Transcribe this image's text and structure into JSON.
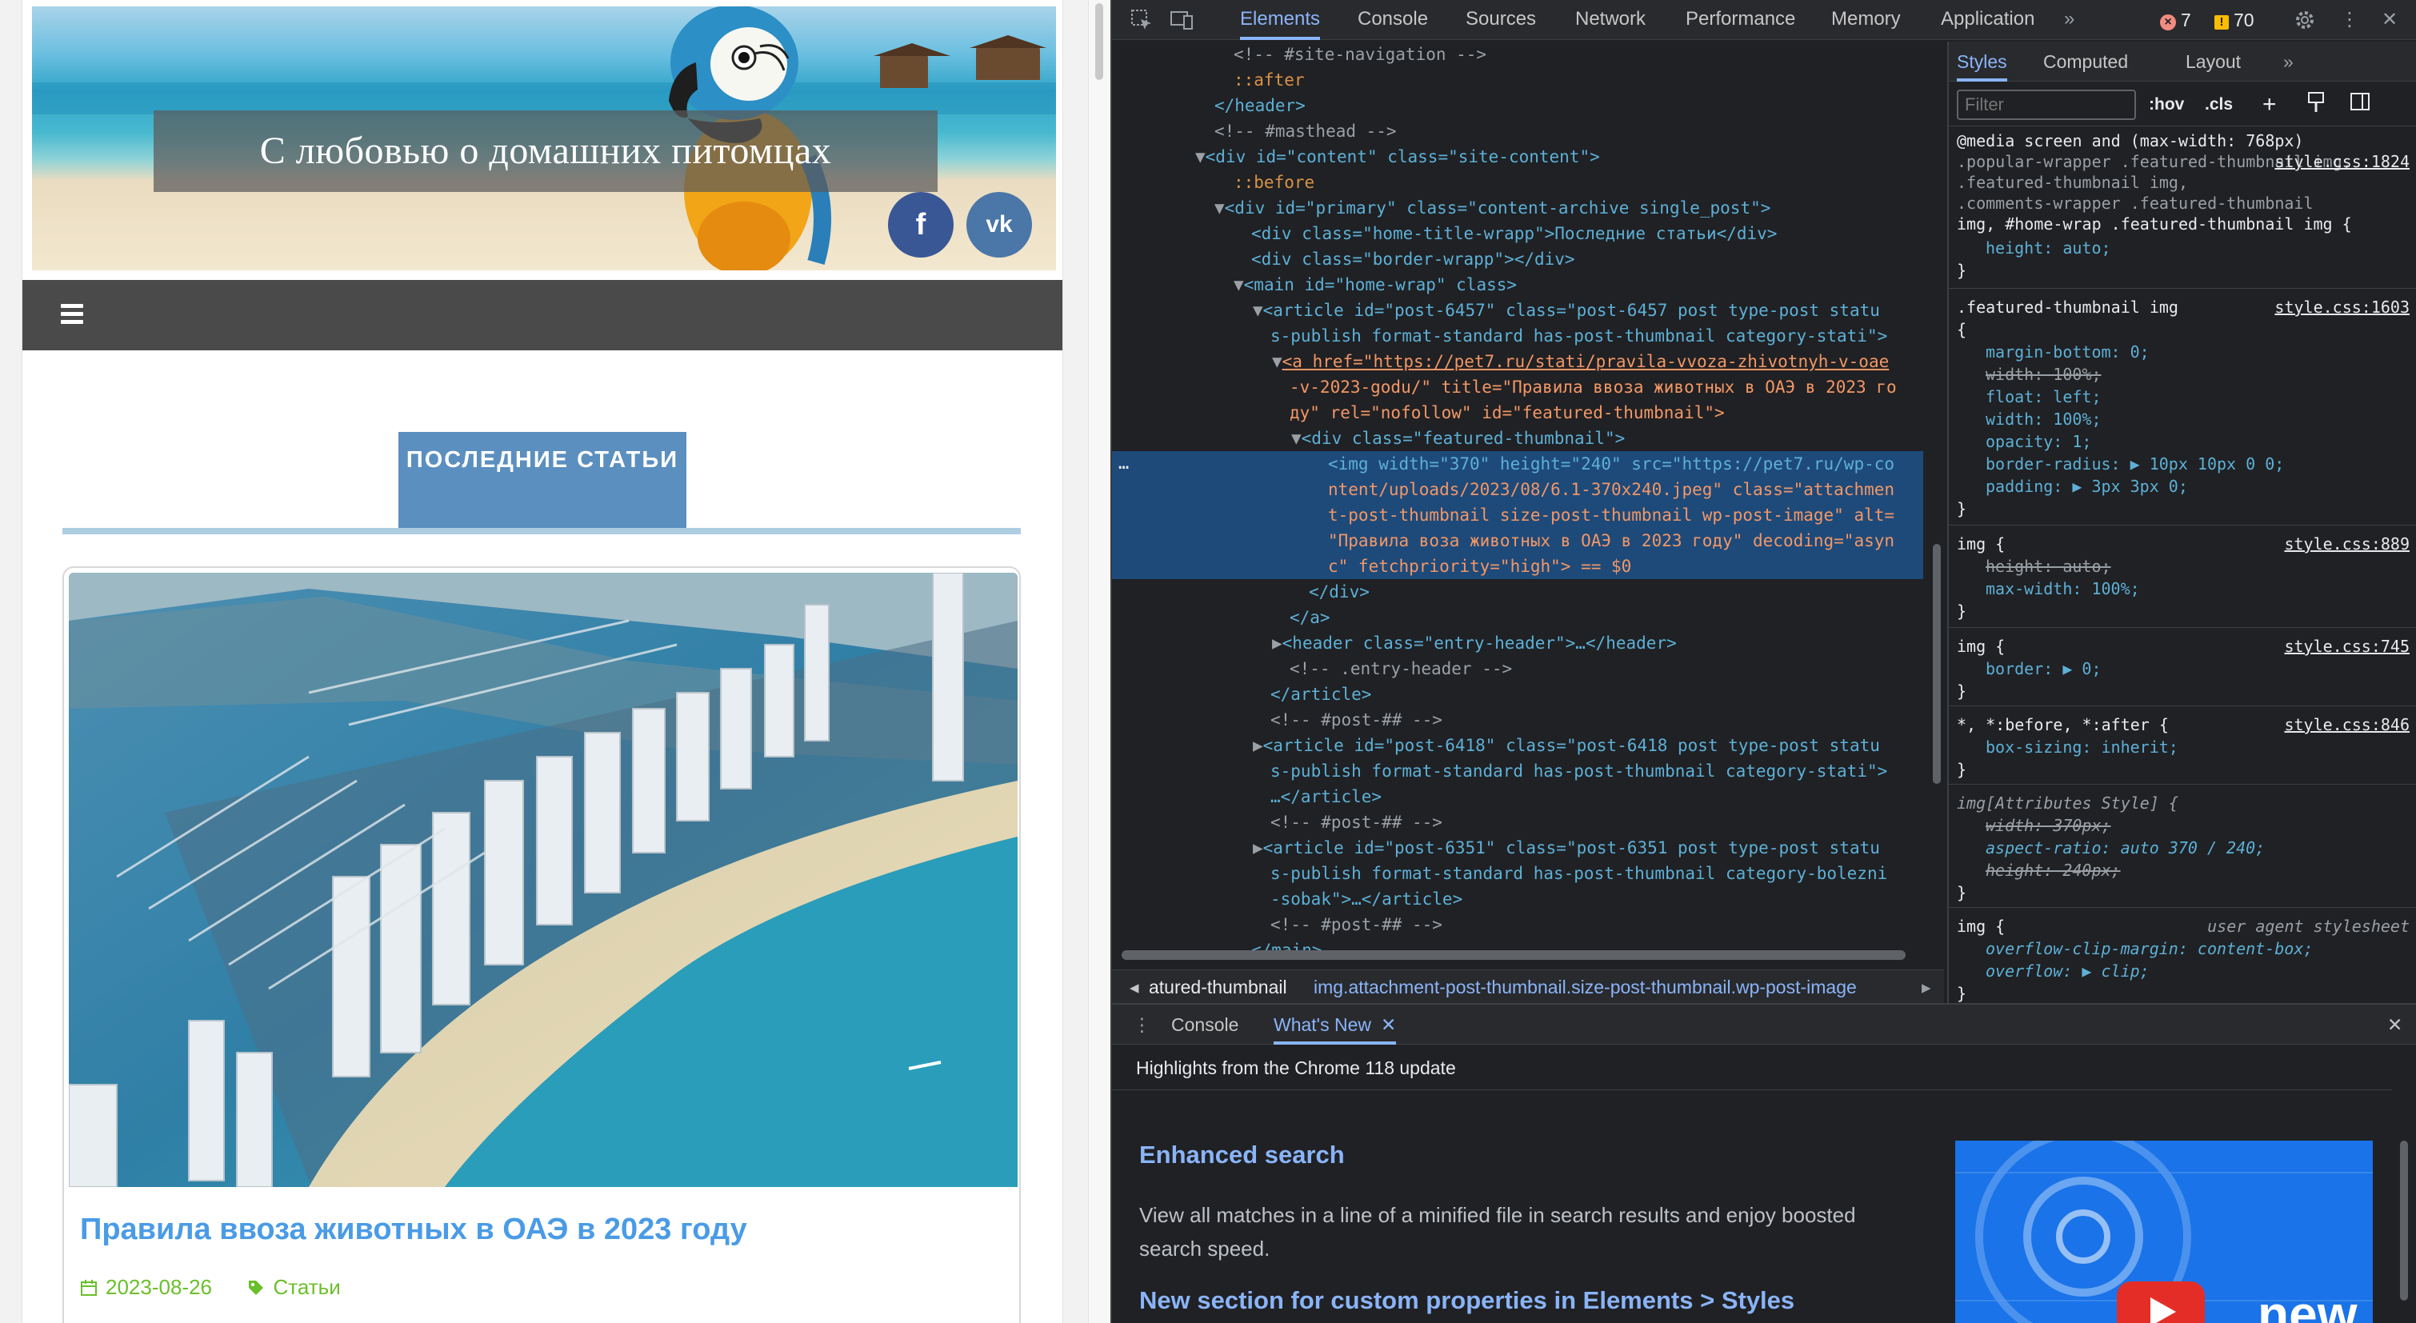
{
  "site": {
    "title": "С любовью о домашних питомцах",
    "social": {
      "facebook": "f",
      "vk": "vk"
    },
    "section_label": "ПОСЛЕДНИЕ СТАТЬИ",
    "post": {
      "title": "Правила ввоза животных в ОАЭ в 2023 году",
      "date": "2023-08-26",
      "category": "Статьи"
    },
    "colors": {
      "nav": "#4a4a4a",
      "tab": "#5b8fbf",
      "title": "#4a9be6",
      "meta": "#6bbf2a"
    }
  },
  "devtools": {
    "tabs": [
      "Elements",
      "Console",
      "Sources",
      "Network",
      "Performance",
      "Memory",
      "Application"
    ],
    "active_tab": "Elements",
    "more_tabs": "»",
    "errors": "7",
    "warnings": "70",
    "dom_lines": [
      "<!-- #site-navigation -->",
      "::after",
      "</header>",
      "<!-- #masthead -->",
      "<div id=\"content\" class=\"site-content\">",
      "::before",
      "<div id=\"primary\" class=\"content-archive single_post\">",
      "<div class=\"home-title-wrapp\">Последние статьи</div>",
      "<div class=\"border-wrapp\"></div>",
      "<main id=\"home-wrap\" class>",
      "<article id=\"post-6457\" class=\"post-6457 post type-post statu",
      "s-publish format-standard has-post-thumbnail category-stati\">",
      "<a href=\"https://pet7.ru/stati/pravila-vvoza-zhivotnyh-v-oae",
      "-v-2023-godu/\" title=\"Правила ввоза животных в ОАЭ в 2023 го",
      "ду\" rel=\"nofollow\" id=\"featured-thumbnail\">",
      "<div class=\"featured-thumbnail\">",
      "<img width=\"370\" height=\"240\" src=\"https://pet7.ru/wp-co",
      "ntent/uploads/2023/08/6.1-370x240.jpeg\" class=\"attachmen",
      "t-post-thumbnail size-post-thumbnail wp-post-image\" alt=",
      "\"Правила воза животных в ОАЭ в 2023 году\" decoding=\"asyn",
      "c\" fetchpriority=\"high\"> == $0",
      "</div>",
      "</a>",
      "<header class=\"entry-header\">…</header>",
      "<!-- .entry-header -->",
      "</article>",
      "<!-- #post-## -->",
      "<article id=\"post-6418\" class=\"post-6418 post type-post statu",
      "s-publish format-standard has-post-thumbnail category-stati\">",
      "…</article>",
      "<!-- #post-## -->",
      "<article id=\"post-6351\" class=\"post-6351 post type-post statu",
      "s-publish format-standard has-post-thumbnail category-bolezni",
      "-sobak\">…</article>",
      "<!-- #post-## -->",
      "</main>"
    ],
    "breadcrumb": [
      "atured-thumbnail",
      "img.attachment-post-thumbnail.size-post-thumbnail.wp-post-image"
    ],
    "styles": {
      "tabs": [
        "Styles",
        "Computed",
        "Layout"
      ],
      "active": "Styles",
      "filter_placeholder": "Filter",
      "hov": ":hov",
      "cls": ".cls",
      "rules": [
        "@media screen and (max-width: 768px)",
        ".popular-wrapper .featured-thumbnail img,",
        ".featured-thumbnail img,",
        ".comments-wrapper .featured-thumbnail",
        "img, #home-wrap .featured-thumbnail img {",
        "height: auto;",
        ".featured-thumbnail img",
        "margin-bottom: 0;",
        "width: 100%;",
        "float: left;",
        "width: 100%;",
        "opacity: 1;",
        "border-radius: ▶ 10px 10px 0 0;",
        "padding: ▶ 3px 3px 0;",
        "img {",
        "height: auto;",
        "max-width: 100%;",
        "img {",
        "border: ▶ 0;",
        "*, *:before, *:after {",
        "box-sizing: inherit;",
        "img[Attributes Style] {",
        "width: 370px;",
        "aspect-ratio: auto 370 / 240;",
        "height: 240px;",
        "img {",
        "overflow-clip-margin: content-box;",
        "overflow: ▶ clip;"
      ],
      "sources": [
        "style.css:1824",
        "style.css:1603",
        "style.css:889",
        "style.css:745",
        "style.css:846",
        "user agent stylesheet"
      ]
    },
    "drawer": {
      "tabs": [
        "Console",
        "What's New"
      ],
      "active": "What's New",
      "header": "Highlights from the Chrome 118 update",
      "h1": "Enhanced search",
      "p1": "View all matches in a line of a minified file in search results and enjoy boosted search speed.",
      "h2": "New section for custom properties in Elements > Styles",
      "video_label": "new"
    }
  }
}
